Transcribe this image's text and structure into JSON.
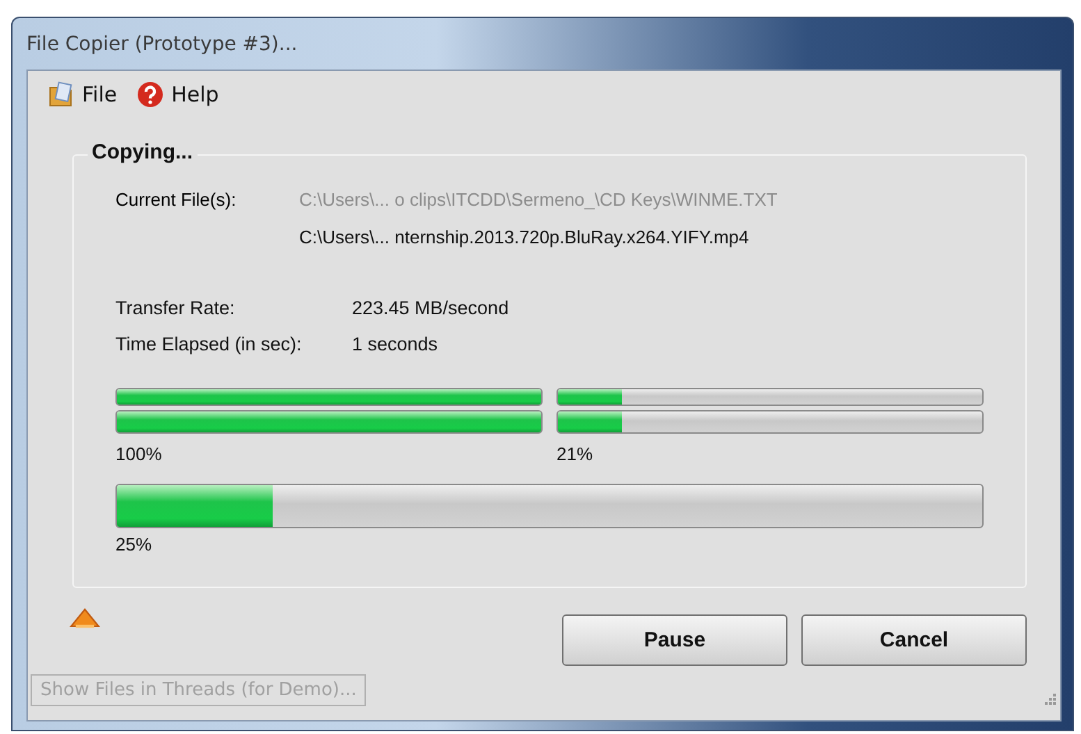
{
  "window": {
    "title": "File Copier (Prototype #3)..."
  },
  "menu": [
    {
      "label": "File",
      "kind": "file"
    },
    {
      "label": "Help",
      "kind": "help"
    }
  ],
  "group": {
    "title": "Copying...",
    "current_label": "Current File(s):",
    "current_files": [
      {
        "path": "C:\\Users\\... o clips\\ITCDD\\Sermeno_\\CD Keys\\WINME.TXT",
        "disabled": true
      },
      {
        "path": "C:\\Users\\... nternship.2013.720p.BluRay.x264.YIFY.mp4",
        "disabled": false
      }
    ],
    "stats": [
      {
        "label": "Transfer Rate:",
        "value": "223.45 MB/second"
      },
      {
        "label": "Time Elapsed (in sec):",
        "value": "1 seconds"
      }
    ],
    "thread_bars": [
      {
        "bars": [
          {
            "level": 1.0
          },
          {
            "level": 1.0
          }
        ],
        "reading": "100%"
      },
      {
        "bars": [
          {
            "level": 0.15
          },
          {
            "level": 0.15
          }
        ],
        "reading": "21%"
      }
    ],
    "overall": {
      "level": 0.18,
      "reading": "25%"
    }
  },
  "buttons": [
    {
      "label": "Pause"
    },
    {
      "label": "Cancel"
    }
  ],
  "demo_button": {
    "label": "Show Files in Threads (for Demo)...",
    "disabled": true
  }
}
